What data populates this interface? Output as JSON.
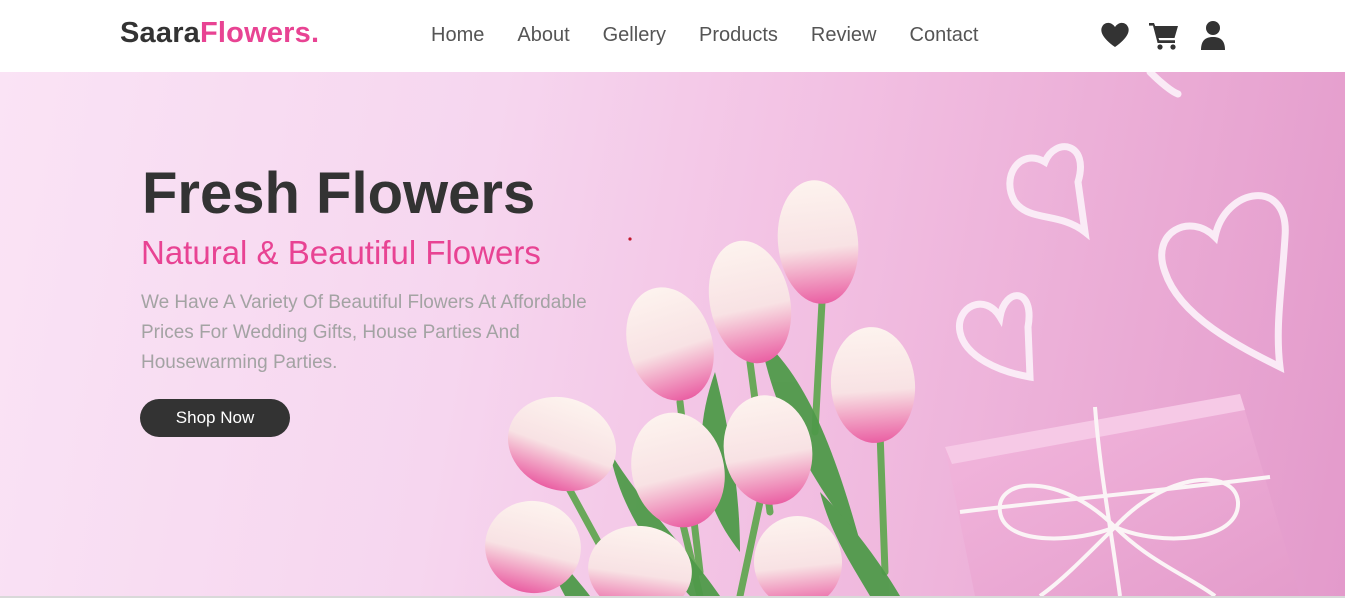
{
  "brand": {
    "name_part1": "Saara",
    "name_part2": "Flowers."
  },
  "nav": {
    "items": [
      {
        "label": "Home"
      },
      {
        "label": "About"
      },
      {
        "label": "Gellery"
      },
      {
        "label": "Products"
      },
      {
        "label": "Review"
      },
      {
        "label": "Contact"
      }
    ]
  },
  "header_icons": [
    "heart-icon",
    "cart-icon",
    "user-icon"
  ],
  "hero": {
    "title": "Fresh Flowers",
    "subtitle": "Natural & Beautiful Flowers",
    "description": "We Have A Variety Of Beautiful Flowers At Affordable Prices For Wedding Gifts, House Parties And Housewarming Parties.",
    "button_label": "Shop Now"
  },
  "colors": {
    "accent": "#e84393",
    "dark": "#333333",
    "muted_text": "#a3a3a3",
    "hero_background": "#f6d6ef"
  }
}
